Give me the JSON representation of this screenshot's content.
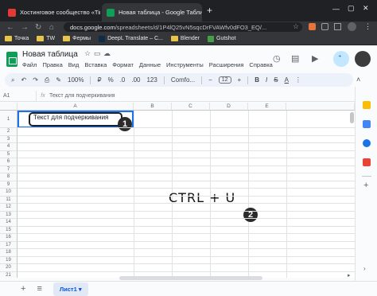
{
  "browser": {
    "tabs": [
      {
        "title": "Хостинговое сообщество «Tim",
        "active": false,
        "favicon_color": "#e53935"
      },
      {
        "title": "Новая таблица - Google Табли",
        "active": true,
        "favicon_color": "#0f9d58"
      }
    ],
    "new_tab": "+",
    "url_host": "docs.google.com",
    "url_path": "/spreadsheets/d/1P4lQ25vN5sqcDrFVAWfv0dFO3_EQ/...",
    "bookmarks": [
      {
        "label": "Точка",
        "type": "folder"
      },
      {
        "label": "TW",
        "type": "folder"
      },
      {
        "label": "Фермы",
        "type": "folder"
      },
      {
        "label": "DeepL Translate – С...",
        "type": "link"
      },
      {
        "label": "Blender",
        "type": "folder"
      },
      {
        "label": "Gutshot",
        "type": "link"
      }
    ]
  },
  "sheets": {
    "title": "Новая таблица",
    "menu": [
      "Файл",
      "Правка",
      "Вид",
      "Вставка",
      "Формат",
      "Данные",
      "Инструменты",
      "Расширения",
      "Справка"
    ],
    "toolbar": {
      "zoom": "100%",
      "currency": "₽",
      "percent": "%",
      "decimals_less": ".0",
      "decimals_more": ".00",
      "number_format": "123",
      "font": "Comfo...",
      "font_size": "12",
      "bold": "B",
      "italic": "I",
      "strike": "S",
      "text_color": "A"
    },
    "name_box": "A1",
    "formula_value": "Текст для подчеркивания",
    "columns": [
      "A",
      "B",
      "C",
      "D",
      "E"
    ],
    "rows": [
      "1",
      "2",
      "3",
      "4",
      "5",
      "6",
      "7",
      "8",
      "9",
      "10",
      "11",
      "12",
      "13",
      "14",
      "15",
      "16",
      "17",
      "18",
      "19",
      "20",
      "21"
    ],
    "cell_a1": "Текст для подчеркивания",
    "sheet_tab": "Лист1"
  },
  "annotations": {
    "step1": "1",
    "step2": "2",
    "shortcut": "CTRL + U"
  },
  "colors": {
    "accent": "#1a73e8",
    "sheets_green": "#0f9d58",
    "chrome_dark": "#202124"
  }
}
